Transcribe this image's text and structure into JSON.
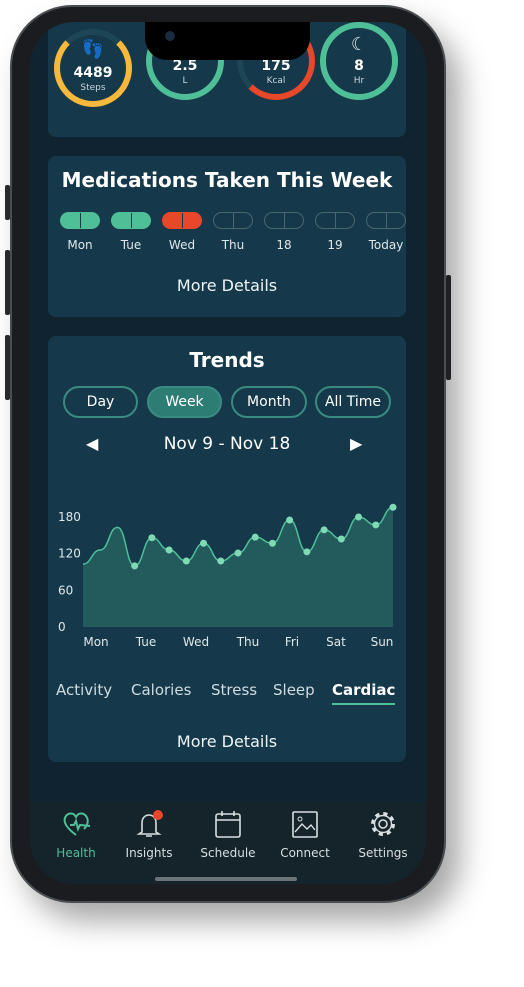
{
  "stats": [
    {
      "value": "4489",
      "unit": "Steps",
      "icon": "footprints-icon",
      "color": "#f6b93b",
      "fill": 0.8
    },
    {
      "value": "2.5",
      "unit": "L",
      "icon": "water-icon",
      "color": "#4fbf98",
      "fill": 1
    },
    {
      "value": "175",
      "unit": "Kcal",
      "icon": "flame-icon",
      "color": "#e8472a",
      "fill": 0.45
    },
    {
      "value": "8",
      "unit": "Hr",
      "icon": "moon-icon",
      "color": "#4fbf98",
      "fill": 1
    }
  ],
  "medications": {
    "title": "Medications Taken This Week",
    "more": "More Details",
    "days": [
      {
        "label": "Mon",
        "status": "taken"
      },
      {
        "label": "Tue",
        "status": "taken"
      },
      {
        "label": "Wed",
        "status": "missed"
      },
      {
        "label": "Thu",
        "status": "pending"
      },
      {
        "label": "18",
        "status": "pending"
      },
      {
        "label": "19",
        "status": "pending"
      },
      {
        "label": "Today",
        "status": "pending"
      }
    ]
  },
  "trends": {
    "title": "Trends",
    "ranges": [
      "Day",
      "Week",
      "Month",
      "All Time"
    ],
    "selected_range": "Week",
    "date_range": "Nov 9 - Nov 18",
    "categories": [
      "Activity",
      "Calories",
      "Stress",
      "Sleep",
      "Cardiac"
    ],
    "selected_category": "Cardiac",
    "more": "More Details"
  },
  "chart_data": {
    "type": "area",
    "x_labels": [
      "Mon",
      "Tue",
      "Wed",
      "Thu",
      "Fri",
      "Sat",
      "Sun"
    ],
    "yticks": [
      "0",
      "60",
      "120",
      "180"
    ],
    "ylim": [
      0,
      200
    ],
    "values": [
      103,
      126,
      163,
      100,
      146,
      126,
      108,
      137,
      108,
      121,
      147,
      137,
      175,
      123,
      159,
      144,
      180,
      167,
      196
    ],
    "marker_from_index": 3,
    "line_color": "#4fbf98",
    "fill_color": "#235a5c"
  },
  "nav": [
    {
      "label": "Health",
      "active": true
    },
    {
      "label": "Insights",
      "badge": true
    },
    {
      "label": "Schedule"
    },
    {
      "label": "Connect"
    },
    {
      "label": "Settings"
    }
  ],
  "colors": {
    "accent": "#4fbf98",
    "alert": "#e8472a",
    "card": "#15394a"
  }
}
